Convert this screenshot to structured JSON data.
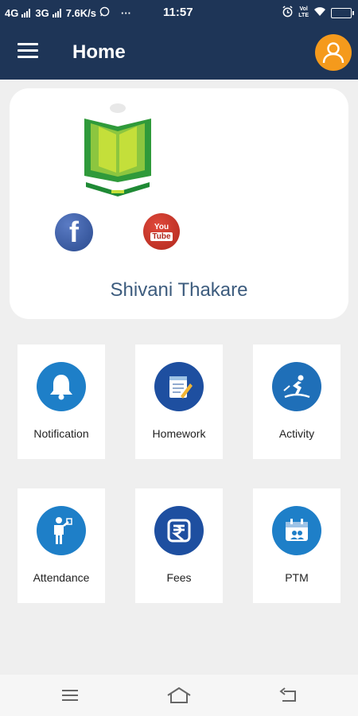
{
  "status_bar": {
    "network1": "4G",
    "network2": "3G",
    "speed": "7.6K/s",
    "overflow": "···",
    "time": "11:57",
    "volte_top": "Vol",
    "volte_bottom": "LTE"
  },
  "app_bar": {
    "title": "Home",
    "menu_icon": "hamburger-menu-icon",
    "profile_icon": "user-icon",
    "profile_color": "#f59a1c",
    "bar_color": "#1e3557"
  },
  "profile": {
    "name": "Shivani Thakare",
    "facebook_glyph": "f",
    "youtube_line1": "You",
    "youtube_line2": "Tube"
  },
  "menu_tiles": [
    {
      "label": "Notification",
      "icon": "bell-icon"
    },
    {
      "label": "Homework",
      "icon": "homework-notebook-icon"
    },
    {
      "label": "Activity",
      "icon": "surfing-activity-icon"
    },
    {
      "label": "Attendance",
      "icon": "attendance-person-icon"
    },
    {
      "label": "Fees",
      "icon": "rupee-icon"
    },
    {
      "label": "PTM",
      "icon": "calendar-meeting-icon"
    }
  ],
  "nav": {
    "menu_icon": "recents-icon",
    "home_icon": "home-icon",
    "back_icon": "back-icon"
  }
}
